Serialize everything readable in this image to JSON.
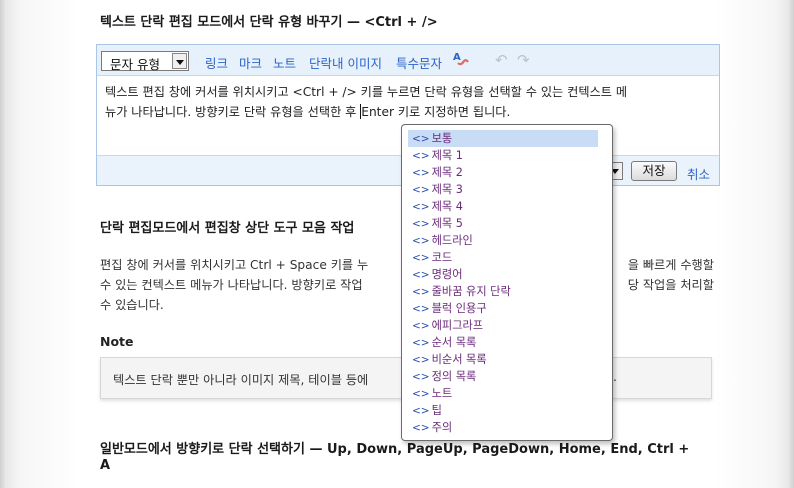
{
  "section1": {
    "heading": "텍스트 단락 편집 모드에서 단락 유형 바꾸기 — <Ctrl + />"
  },
  "editor": {
    "type_select_value": "문자 유형",
    "toolbar_links": [
      "링크",
      "마크",
      "노트",
      "단락내 이미지",
      "특수문자"
    ],
    "text_line1": "텍스트 편집 창에 커서를 위치시키고 <Ctrl + /> 키를 누르면 단락 유형을 선택할 수 있는 컨텍스트 메",
    "text_line2a": "뉴가 나타납니다. 방향키로 단락 유형을 선택한 후 ",
    "text_line2b": "Enter 키로 지정하면 됩니다.",
    "save_label": "저장",
    "cancel_label": "취소"
  },
  "section2": {
    "heading": "단락 편집모드에서 편집창 상단 도구 모음 작업",
    "para_line1a": "편집 창에 커서를 위치시키고 Ctrl + Space 키를 누",
    "para_line1b": "을 빠르게 수행할",
    "para_line2a": "수 있는 컨텍스트 메뉴가 나타납니다. 방향키로 작업",
    "para_line2b": "당 작업을 처리할",
    "para_line3": "수 있습니다."
  },
  "note": {
    "title": "Note",
    "text_a": "텍스트 단락 뿐만 아니라 이미지 제목, 테이블 등에",
    "text_b": "."
  },
  "section3": {
    "heading_line1": "일반모드에서 방향키로 단락 선택하기 — Up, Down, PageUp, PageDown, Home, End, Ctrl +",
    "heading_line2": "A"
  },
  "popup_menu": {
    "tag_glyph": "<>",
    "selected_index": 0,
    "items": [
      "보통",
      "제목 1",
      "제목 2",
      "제목 3",
      "제목 4",
      "제목 5",
      "헤드라인",
      "코드",
      "명령어",
      "줄바꿈 유지 단락",
      "블럭 인용구",
      "에피그라프",
      "순서 목록",
      "비순서 목록",
      "정의 목록",
      "노트",
      "팁",
      "주의"
    ]
  }
}
